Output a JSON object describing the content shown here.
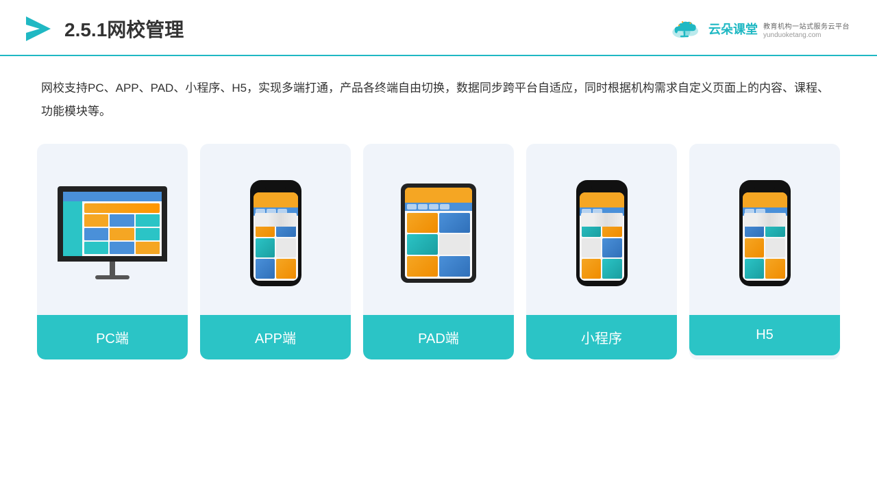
{
  "header": {
    "title": "2.5.1网校管理",
    "brand": {
      "name": "云朵课堂",
      "url": "yunduoketang.com",
      "slogan": "教育机构一站式服务云平台"
    }
  },
  "description": "网校支持PC、APP、PAD、小程序、H5，实现多端打通，产品各终端自由切换，数据同步跨平台自适应，同时根据机构需求自定义页面上的内容、课程、功能模块等。",
  "cards": [
    {
      "id": "pc",
      "label": "PC端",
      "type": "monitor"
    },
    {
      "id": "app",
      "label": "APP端",
      "type": "phone"
    },
    {
      "id": "pad",
      "label": "PAD端",
      "type": "tablet"
    },
    {
      "id": "miniapp",
      "label": "小程序",
      "type": "phone"
    },
    {
      "id": "h5",
      "label": "H5",
      "type": "phone"
    }
  ]
}
